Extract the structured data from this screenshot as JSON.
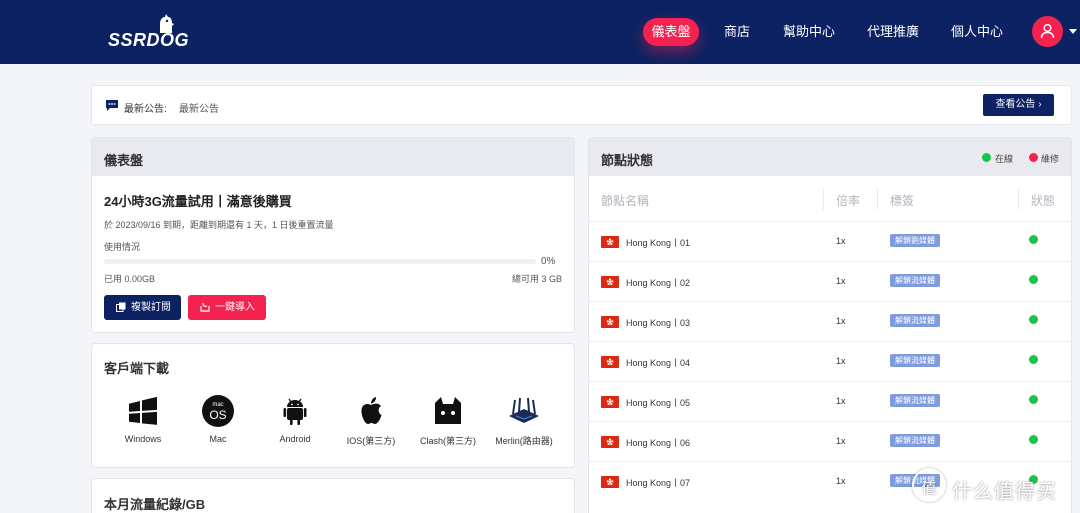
{
  "brand": {
    "logo_text": "SSRDOG"
  },
  "nav": {
    "items": [
      {
        "label": "儀表盤"
      },
      {
        "label": "商店"
      },
      {
        "label": "幫助中心"
      },
      {
        "label": "代理推廣"
      },
      {
        "label": "個人中心"
      }
    ],
    "active": "儀表盤"
  },
  "announcement": {
    "label": "最新公告:",
    "text": "最新公告",
    "button": "查看公告 ›"
  },
  "dashboard": {
    "title": "儀表盤",
    "plan": "24小時3G流量試用丨滿意後購買",
    "expire": "於 2023/09/16 到期，距離到期還有 1 天，1 日後重置流量",
    "usage_label": "使用情況",
    "progress_percent": "0%",
    "progress_value": 0,
    "used": "已用 0.00GB",
    "available": "總可用 3 GB",
    "copy_button": "複製訂閱",
    "import_button": "一鍵導入"
  },
  "clients": {
    "title": "客戶端下載",
    "items": [
      {
        "name": "Windows",
        "icon": "windows-icon"
      },
      {
        "name": "Mac",
        "icon": "macos-icon"
      },
      {
        "name": "Android",
        "icon": "android-icon"
      },
      {
        "name": "IOS(第三方)",
        "icon": "apple-icon"
      },
      {
        "name": "Clash(第三方)",
        "icon": "clash-cat-icon"
      },
      {
        "name": "Merlin(路由器)",
        "icon": "router-icon"
      }
    ]
  },
  "traffic": {
    "title": "本月流量紀錄/GB"
  },
  "nodes": {
    "title": "節點狀態",
    "legend": [
      {
        "label": "在線",
        "color": "#19c24a"
      },
      {
        "label": "維修",
        "color": "#f3224f"
      }
    ],
    "columns": [
      "節點名稱",
      "倍率",
      "標簽",
      "狀態"
    ],
    "rows": [
      {
        "name": "Hong Kong丨01",
        "rate": "1x",
        "tag": "解鎖劉媒體",
        "status": "online"
      },
      {
        "name": "Hong Kong丨02",
        "rate": "1x",
        "tag": "解鎖流媒體",
        "status": "online"
      },
      {
        "name": "Hong Kong丨03",
        "rate": "1x",
        "tag": "解鎖流媒體",
        "status": "online"
      },
      {
        "name": "Hong Kong丨04",
        "rate": "1x",
        "tag": "解鎖流媒體",
        "status": "online"
      },
      {
        "name": "Hong Kong丨05",
        "rate": "1x",
        "tag": "解鎖流媒體",
        "status": "online"
      },
      {
        "name": "Hong Kong丨06",
        "rate": "1x",
        "tag": "解鎖流媒體",
        "status": "online"
      },
      {
        "name": "Hong Kong丨07",
        "rate": "1x",
        "tag": "解鎖流媒體",
        "status": "online"
      }
    ]
  },
  "watermark": {
    "badge": "值",
    "text": "什么值得买"
  },
  "colors": {
    "navy": "#0c2262",
    "accent": "#f3224f",
    "online": "#19c24a",
    "tag": "#7d9bdd"
  }
}
